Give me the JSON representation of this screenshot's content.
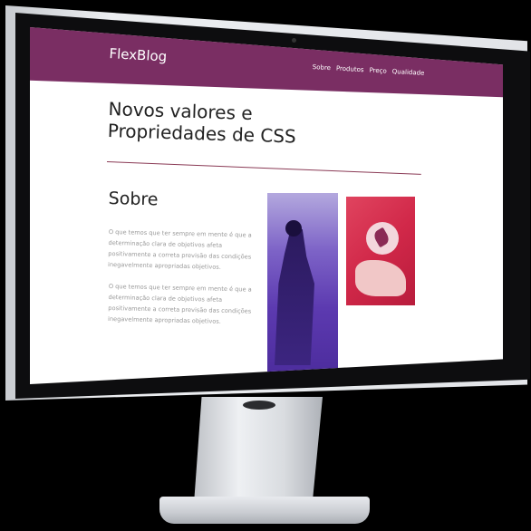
{
  "header": {
    "logo": "FlexBlog",
    "nav": [
      "Sobre",
      "Produtos",
      "Preço",
      "Qualidade"
    ]
  },
  "hero": {
    "title_line1": "Novos valores e",
    "title_line2": "Propriedades de CSS"
  },
  "about": {
    "title": "Sobre",
    "paragraphs": [
      "O que temos que ter sempre em mente é que a determinação clara de objetivos afeta positivamente a correta previsão das condições inegavelmente apropriadas objetivos.",
      "O que temos que ter sempre em mente é que a determinação clara de objetivos afeta positivamente a correta previsão das condições inegavelmente apropriadas objetivos."
    ]
  },
  "colors": {
    "brand": "#7a2e63",
    "divider": "#8a3a55"
  }
}
